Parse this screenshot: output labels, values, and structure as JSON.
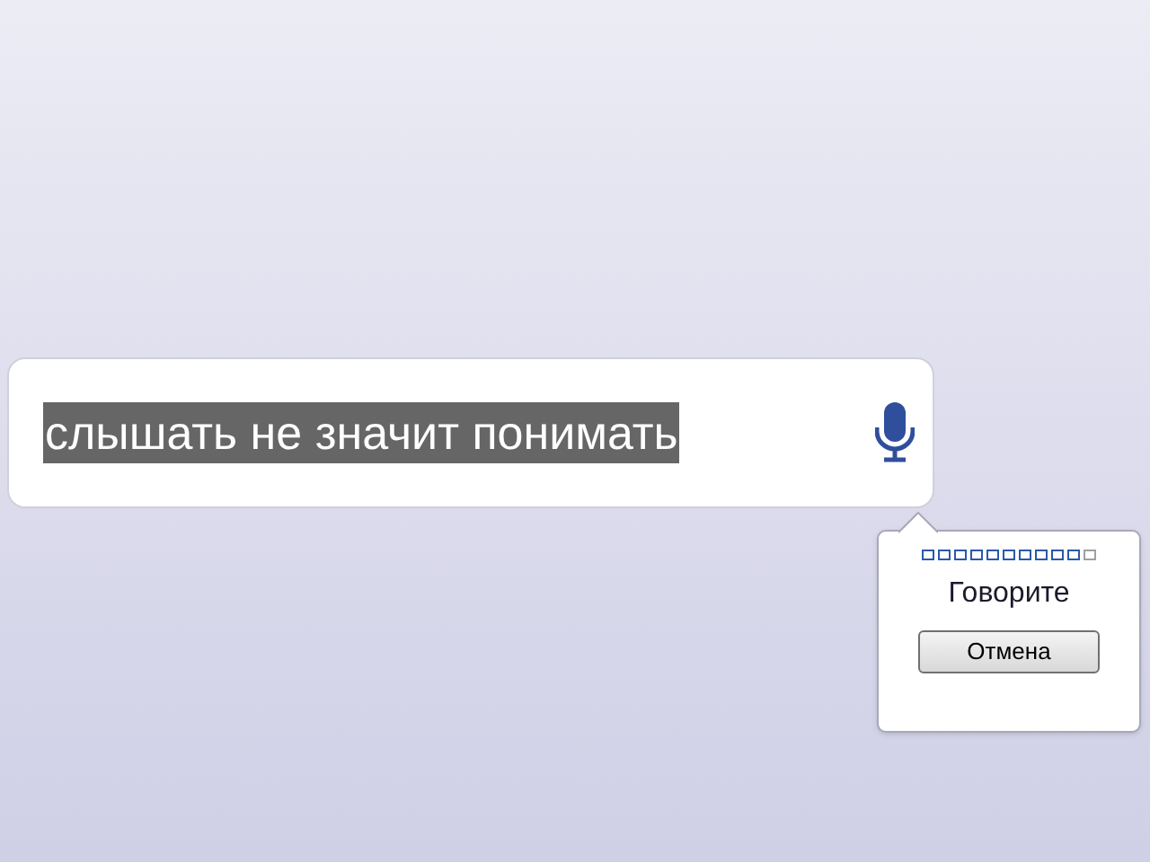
{
  "search": {
    "value": "слышать не значит понимать",
    "selected": true
  },
  "voice_popup": {
    "level": 0.91,
    "status": "Говорите",
    "cancel_button": "Отмена"
  }
}
